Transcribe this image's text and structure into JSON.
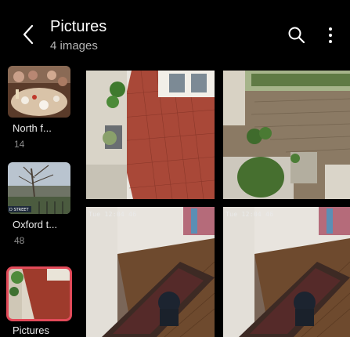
{
  "header": {
    "title": "Pictures",
    "subtitle": "4 images",
    "back_icon": "chevron-left-icon",
    "search_icon": "search-icon",
    "more_icon": "more-vertical-icon"
  },
  "albums": [
    {
      "name": "North f...",
      "count": "14"
    },
    {
      "name": "Oxford t...",
      "count": "48"
    },
    {
      "name": "Pictures",
      "count": ""
    }
  ],
  "album_thumb_labels": {
    "street_sign": "D STREET"
  },
  "photos": [
    {
      "timestamp": ""
    },
    {
      "timestamp": ""
    },
    {
      "timestamp": "Tue 12:04 46"
    },
    {
      "timestamp": "Tue 12:04 46"
    }
  ],
  "colors": {
    "accent": "#e24a59",
    "background": "#000000"
  }
}
